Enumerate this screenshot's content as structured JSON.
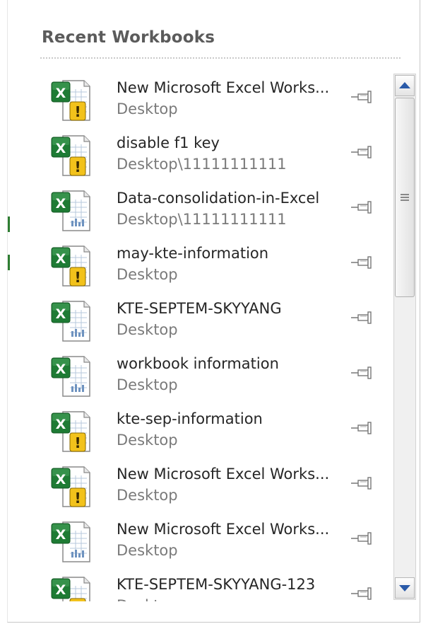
{
  "panel": {
    "heading": "Recent Workbooks"
  },
  "workbooks": [
    {
      "name": "New Microsoft Excel Works...",
      "location": "Desktop",
      "icon": "excel-warning-icon"
    },
    {
      "name": "disable f1 key",
      "location": "Desktop\\11111111111",
      "icon": "excel-warning-icon"
    },
    {
      "name": "Data-consolidation-in-Excel",
      "location": "Desktop\\11111111111",
      "icon": "excel-icon"
    },
    {
      "name": "may-kte-information",
      "location": "Desktop",
      "icon": "excel-warning-icon"
    },
    {
      "name": "KTE-SEPTEM-SKYYANG",
      "location": "Desktop",
      "icon": "excel-icon"
    },
    {
      "name": "workbook information",
      "location": "Desktop",
      "icon": "excel-icon"
    },
    {
      "name": "kte-sep-information",
      "location": "Desktop",
      "icon": "excel-warning-icon"
    },
    {
      "name": "New Microsoft Excel Works...",
      "location": "Desktop",
      "icon": "excel-warning-icon"
    },
    {
      "name": "New Microsoft Excel Works...",
      "location": "Desktop",
      "icon": "excel-icon"
    },
    {
      "name": "KTE-SEPTEM-SKYYANG-123",
      "location": "Desktop",
      "icon": "excel-warning-icon"
    }
  ],
  "icons": {
    "pin": "pin-icon",
    "scroll_up": "scroll-up-arrow-icon",
    "scroll_down": "scroll-down-arrow-icon",
    "thumb_grip": "grip-icon"
  },
  "colors": {
    "excel_green": "#1e7b34",
    "warning_yellow": "#f2c21b",
    "heading": "#5b5b5b",
    "scroll_arrow": "#2a5aa8"
  }
}
